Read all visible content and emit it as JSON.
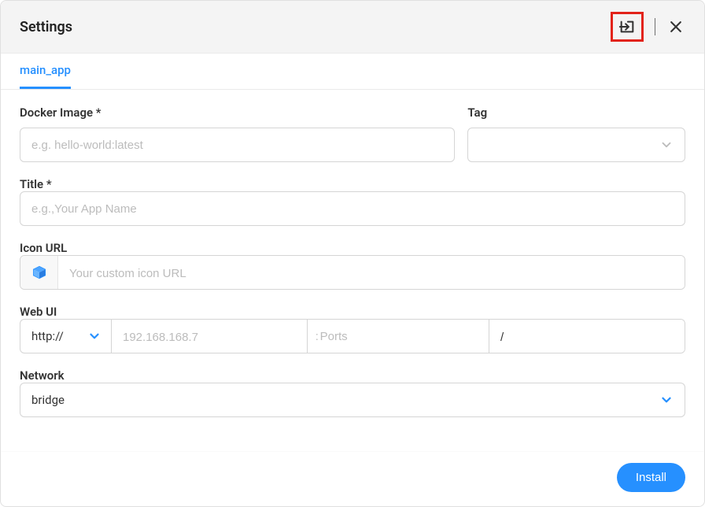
{
  "header": {
    "title": "Settings"
  },
  "tabs": {
    "main": "main_app"
  },
  "form": {
    "dockerImage": {
      "label": "Docker Image *",
      "placeholder": "e.g. hello-world:latest",
      "value": ""
    },
    "tag": {
      "label": "Tag",
      "value": ""
    },
    "title": {
      "label": "Title *",
      "placeholder": "e.g.,Your App Name",
      "value": ""
    },
    "iconUrl": {
      "label": "Icon URL",
      "placeholder": "Your custom icon URL",
      "value": ""
    },
    "webui": {
      "label": "Web UI",
      "protocol": "http://",
      "ipPlaceholder": "192.168.168.7",
      "ipValue": "",
      "portsPrefix": ":",
      "portsPlaceholder": "Ports",
      "portsValue": "",
      "pathValue": "/"
    },
    "network": {
      "label": "Network",
      "value": "bridge"
    }
  },
  "footer": {
    "installLabel": "Install"
  }
}
